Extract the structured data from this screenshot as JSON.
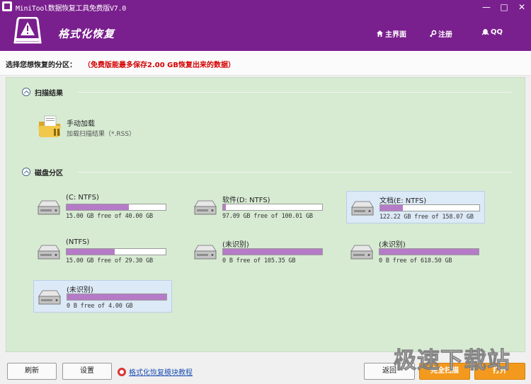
{
  "window": {
    "title": "MiniTool数据恢复工具免费版V7.0",
    "controls": {
      "minimize": "—",
      "maximize": "□",
      "close": "✕"
    }
  },
  "header": {
    "page_title": "格式化恢复",
    "nav": [
      {
        "label": "主界面",
        "icon": "home-icon"
      },
      {
        "label": "注册",
        "icon": "key-icon"
      },
      {
        "label": "QQ",
        "icon": "qq-penguin-icon"
      }
    ],
    "brand_color": "#7a1f8e"
  },
  "subheader": {
    "label": "选择您想恢复的分区：",
    "note": "（免费版能最多保存2.00 GB恢复出来的数据）",
    "note_color": "#d40000"
  },
  "scan_results": {
    "section_title": "扫描结果",
    "manual_load": {
      "title": "手动加载",
      "subtitle": "加载扫描结果（*.RSS）"
    }
  },
  "disk_partitions": {
    "section_title": "磁盘分区",
    "drives": [
      {
        "name": "(C: NTFS)",
        "info": "15.00 GB free of 40.00 GB",
        "used_fraction": 0.625,
        "selected": false
      },
      {
        "name": "软件(D: NTFS)",
        "info": "97.09 GB free of 100.01 GB",
        "used_fraction": 0.029,
        "selected": false
      },
      {
        "name": "文档(E: NTFS)",
        "info": "122.22 GB free of 158.07 GB",
        "used_fraction": 0.227,
        "selected": true
      },
      {
        "name": "(NTFS)",
        "info": "15.00 GB free of 29.30 GB",
        "used_fraction": 0.488,
        "selected": false
      },
      {
        "name": "(未识别)",
        "info": "0 B free of 105.35 GB",
        "used_fraction": 1.0,
        "selected": false
      },
      {
        "name": "(未识别)",
        "info": "0 B free of 618.50 GB",
        "used_fraction": 1.0,
        "selected": false
      },
      {
        "name": "(未识别)",
        "info": "0 B free of 4.00 GB",
        "used_fraction": 1.0,
        "selected": true
      }
    ]
  },
  "toolbar": {
    "refresh": "刷新",
    "settings": "设置",
    "help_link": "格式化恢复模块教程",
    "back": "返回",
    "full_scan": "完全扫描",
    "open": "打开"
  },
  "watermark": "极速下载站"
}
